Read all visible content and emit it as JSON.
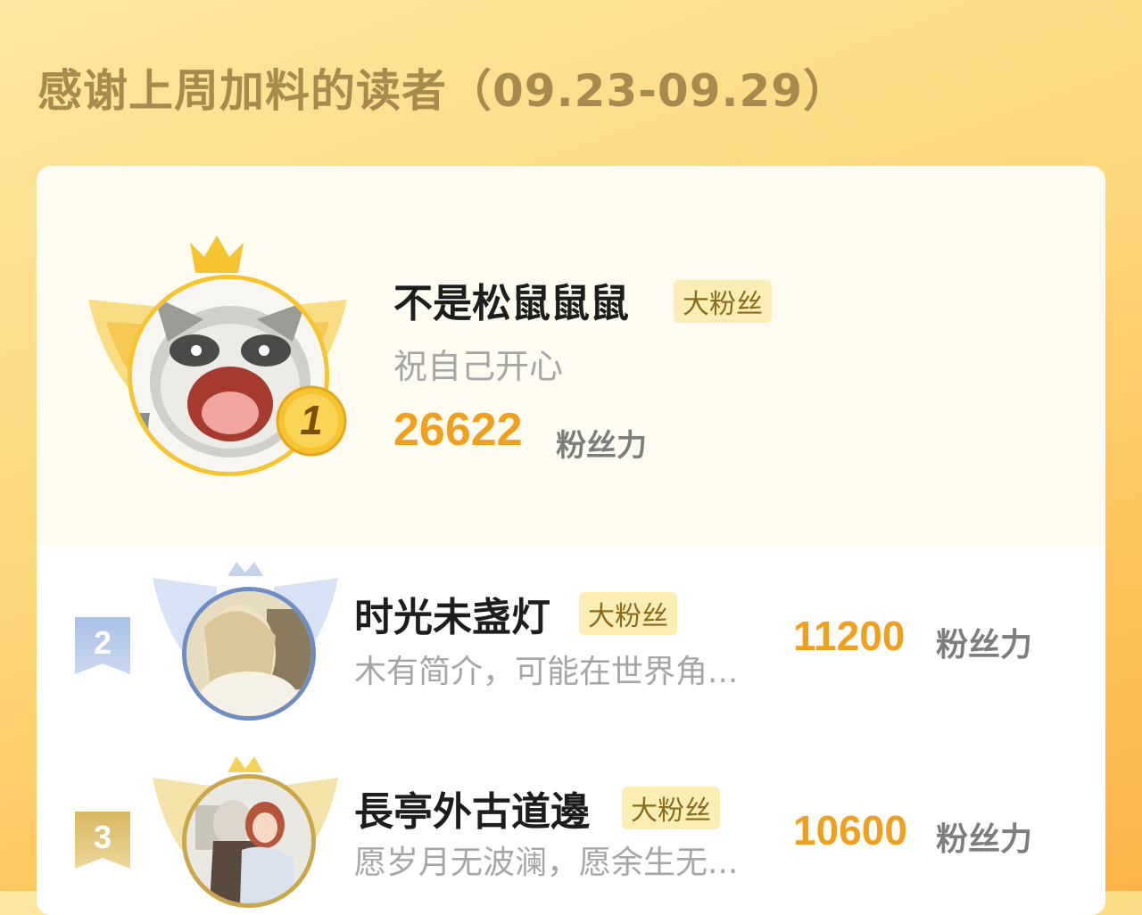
{
  "header": {
    "title": "感谢上周加料的读者（09.23-09.29）"
  },
  "top_fan": {
    "rank": "1",
    "name": "不是松鼠鼠鼠",
    "badge": "大粉丝",
    "motto": "祝自己开心",
    "score": "26622",
    "score_unit": "粉丝力",
    "avatar": "raccoon-avatar"
  },
  "fans": [
    {
      "rank": "2",
      "name": "时光未盏灯",
      "badge": "大粉丝",
      "motto": "木有简介，可能在世界角...",
      "score": "11200",
      "score_unit": "粉丝力",
      "avatar": "illustrated-woman-avatar",
      "rank_color": "#9eb7dd"
    },
    {
      "rank": "3",
      "name": "長亭外古道邊",
      "badge": "大粉丝",
      "motto": "愿岁月无波澜，愿余生无...",
      "score": "10600",
      "score_unit": "粉丝力",
      "avatar": "illustrated-couple-avatar",
      "rank_color": "#d8b760"
    }
  ],
  "colors": {
    "accent": "#f0a020",
    "gold": "#f6c431",
    "silver": "#a9c0e6",
    "bronze": "#d8b760"
  }
}
